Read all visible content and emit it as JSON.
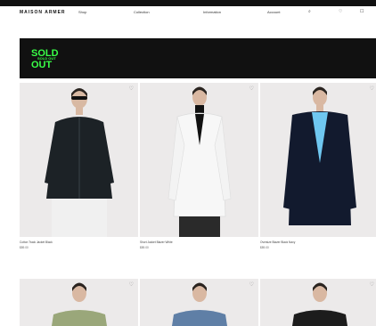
{
  "window": {
    "title": "Sold Out Store"
  },
  "topbar": {
    "text": ""
  },
  "header": {
    "brand": "MAISON ARMER",
    "nav": [
      "Shop",
      "Collection",
      "Information",
      "Account"
    ],
    "icons": [
      "search-icon",
      "heart-icon",
      "bag-icon"
    ]
  },
  "banner": {
    "logo_text": "SOLD OUT"
  },
  "products": [
    {
      "name": "Cotton Track Jacket Black",
      "price": "$89.00",
      "garment": "black jacket",
      "color": "#1c2226"
    },
    {
      "name": "Short Jacket Blazer White",
      "price": "$89.00",
      "garment": "white blazer",
      "color": "#f7f7f7"
    },
    {
      "name": "Oversize Blazer Black Navy",
      "price": "$89.00",
      "garment": "navy blazer",
      "color": "#121a2e"
    }
  ],
  "products_row2": [
    {
      "garment": "olive top",
      "color": "#9aa77a"
    },
    {
      "garment": "blue top",
      "color": "#5f7fa6"
    },
    {
      "garment": "black top",
      "color": "#1c1c1c"
    }
  ],
  "accent": {
    "banner_bg": "#111111",
    "logo_green": "#39ff47"
  }
}
